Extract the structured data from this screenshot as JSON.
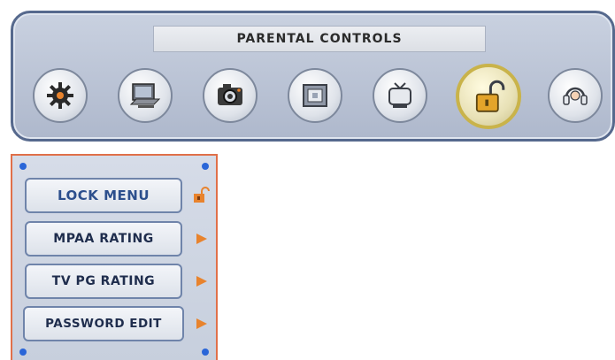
{
  "header": {
    "title": "PARENTAL CONTROLS"
  },
  "icons": [
    {
      "name": "settings-gear-icon",
      "selected": false
    },
    {
      "name": "pc-monitor-icon",
      "selected": false
    },
    {
      "name": "camera-icon",
      "selected": false
    },
    {
      "name": "screen-window-icon",
      "selected": false
    },
    {
      "name": "tv-icon",
      "selected": false
    },
    {
      "name": "lock-icon",
      "selected": true
    },
    {
      "name": "help-headset-icon",
      "selected": false
    }
  ],
  "menu": {
    "items": [
      {
        "label": "LOCK MENU",
        "indicator": "padlock-unlocked-icon"
      },
      {
        "label": "MPAA RATING",
        "indicator": "arrow-right-icon"
      },
      {
        "label": "TV PG RATING",
        "indicator": "arrow-right-icon"
      },
      {
        "label": "PASSWORD EDIT",
        "indicator": "arrow-right-icon"
      }
    ]
  },
  "colors": {
    "accent_orange": "#e8832d",
    "panel_border": "#e0704a",
    "corner_dot": "#2a66d8",
    "selected_ring": "#c9b34a"
  }
}
